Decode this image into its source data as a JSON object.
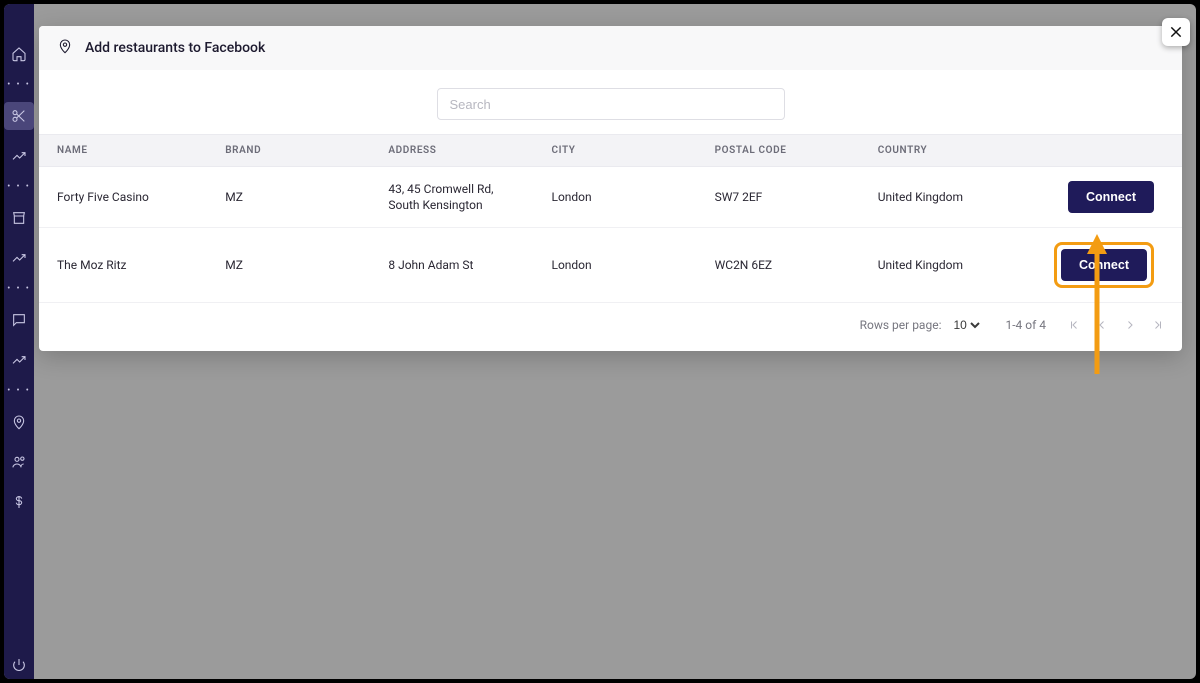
{
  "modal": {
    "title": "Add restaurants to Facebook",
    "search_placeholder": "Search"
  },
  "table": {
    "headers": {
      "name": "NAME",
      "brand": "BRAND",
      "address": "ADDRESS",
      "city": "CITY",
      "postal": "POSTAL CODE",
      "country": "COUNTRY"
    },
    "rows": [
      {
        "name": "Forty Five Casino",
        "brand": "MZ",
        "address": "43, 45 Cromwell Rd, South Kensington",
        "city": "London",
        "postal": "SW7 2EF",
        "country": "United Kingdom",
        "action_label": "Connect",
        "highlighted": false
      },
      {
        "name": "The Moz Ritz",
        "brand": "MZ",
        "address": "8 John Adam St",
        "city": "London",
        "postal": "WC2N 6EZ",
        "country": "United Kingdom",
        "action_label": "Connect",
        "highlighted": true
      }
    ]
  },
  "pagination": {
    "rows_per_page_label": "Rows per page:",
    "rows_per_page_value": "10",
    "range_label": "1-4 of 4"
  }
}
